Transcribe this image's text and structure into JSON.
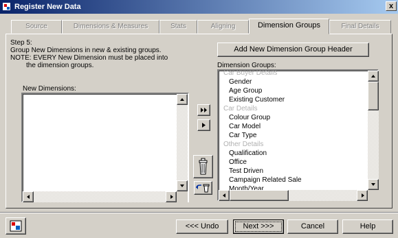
{
  "window": {
    "title": "Register New Data",
    "close_label": "x"
  },
  "tabs": [
    {
      "label": "Source",
      "active": false
    },
    {
      "label": "Dimensions & Measures",
      "active": false
    },
    {
      "label": "Stats",
      "active": false
    },
    {
      "label": "Aligning",
      "active": false
    },
    {
      "label": "Dimension Groups",
      "active": true
    },
    {
      "label": "Final Details",
      "active": false
    }
  ],
  "instructions": {
    "line1": "Step 5:",
    "line2": "Group New Dimensions in new & existing groups.",
    "line3": "NOTE: EVERY New Dimension must be placed into",
    "line4": "the dimension groups."
  },
  "add_group_button_label": "Add New Dimension Group Header",
  "new_dimensions": {
    "label": "New Dimensions:",
    "items": []
  },
  "dimension_groups": {
    "label": "Dimension Groups:",
    "items": [
      {
        "text": "Car Buyer Details",
        "kind": "header"
      },
      {
        "text": "Gender",
        "kind": "child"
      },
      {
        "text": "Age Group",
        "kind": "child"
      },
      {
        "text": "Existing Customer",
        "kind": "child"
      },
      {
        "text": "Car Details",
        "kind": "header"
      },
      {
        "text": "Colour Group",
        "kind": "child"
      },
      {
        "text": "Car Model",
        "kind": "child"
      },
      {
        "text": "Car Type",
        "kind": "child"
      },
      {
        "text": "Other Details",
        "kind": "header"
      },
      {
        "text": "Qualification",
        "kind": "child"
      },
      {
        "text": "Office",
        "kind": "child"
      },
      {
        "text": "Test Driven",
        "kind": "child"
      },
      {
        "text": "Campaign Related Sale",
        "kind": "child"
      },
      {
        "text": "Month/Year",
        "kind": "child"
      }
    ]
  },
  "footer": {
    "undo_label": "<<< Undo",
    "next_label": "Next >>>",
    "cancel_label": "Cancel",
    "help_label": "Help"
  },
  "icons": {
    "move_all": "double-right-arrow-icon",
    "move_one": "right-arrow-icon",
    "delete": "trash-icon",
    "undo_delete": "undo-trash-icon",
    "app": "app-icon"
  },
  "colors": {
    "titlebar_start": "#0a246a",
    "titlebar_end": "#a6caf0",
    "face": "#d4d0c8",
    "group_header_text": "#b0b0b0"
  }
}
